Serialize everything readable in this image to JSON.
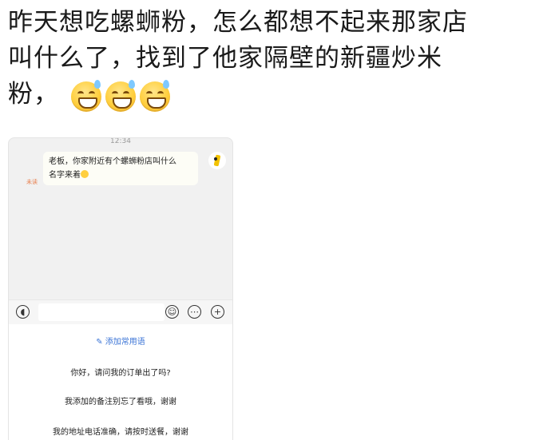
{
  "post": {
    "line1": "昨天想吃螺蛳粉，怎么都想不起来那家店",
    "line2": "叫什么了，找到了他家隔壁的新疆炒米",
    "line3": "粉，",
    "emoji_icon": "grinning-sweat-emoji"
  },
  "chat": {
    "time": "12:34",
    "bubble_line1": "老板，你家附近有个螺蛳粉店叫什么",
    "bubble_line2": "名字来着",
    "unread_label": "未读",
    "input": {
      "voice_icon": "voice-icon",
      "emoji_icon": "emoji-icon",
      "more_icon": "more-icon",
      "plus_icon": "plus-icon"
    },
    "add_phrase_label": "添加常用语",
    "phrases": [
      "你好，请问我的订单出了吗?",
      "我添加的备注别忘了看哦，谢谢",
      "我的地址电话准确，请按时送餐，谢谢"
    ]
  },
  "colors": {
    "link": "#3b74d6",
    "unread": "#e8804f",
    "chat_bg": "#f1f1f1"
  }
}
